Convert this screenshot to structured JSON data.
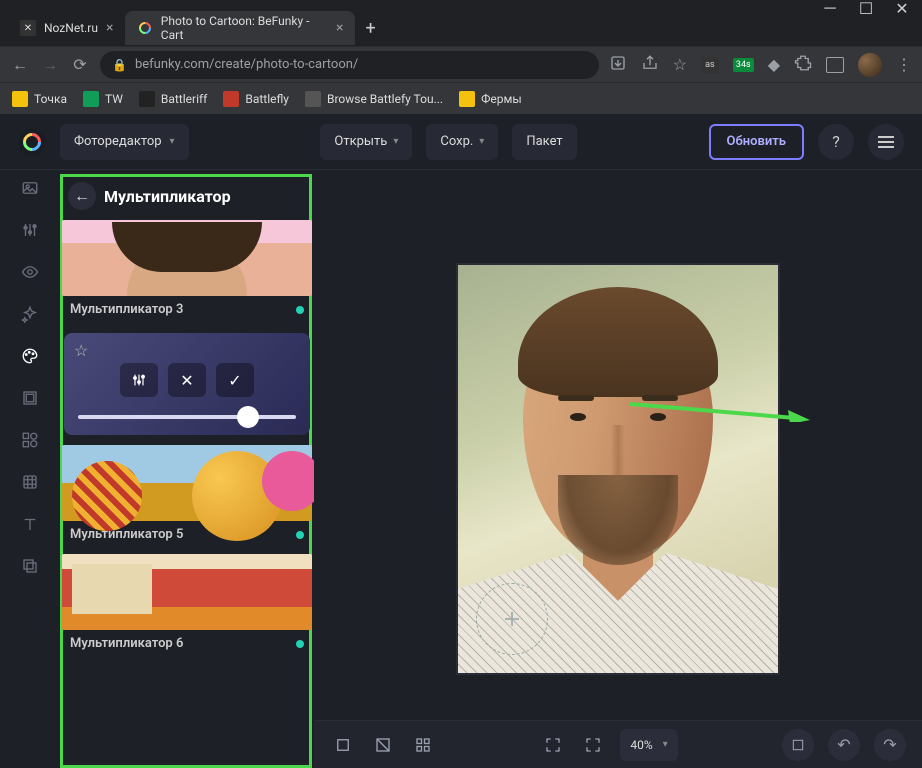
{
  "browser": {
    "tabs": [
      {
        "title": "NozNet.ru",
        "active": false
      },
      {
        "title": "Photo to Cartoon: BeFunky - Cart",
        "active": true
      }
    ],
    "url": "befunky.com/create/photo-to-cartoon/",
    "bookmarks": [
      {
        "label": "Точка",
        "color": "#f4c20d"
      },
      {
        "label": "TW",
        "color": "#0f9d58"
      },
      {
        "label": "Battleriff",
        "color": "#333"
      },
      {
        "label": "Battlefly",
        "color": "#c0392b"
      },
      {
        "label": "Browse Battlefy Tou...",
        "color": "#555"
      },
      {
        "label": "Фермы",
        "color": "#f4c20d"
      }
    ],
    "ext_badge": "34s"
  },
  "appbar": {
    "mode": "Фоторедактор",
    "open": "Открыть",
    "save": "Сохр.",
    "batch": "Пакет",
    "upgrade": "Обновить"
  },
  "panel": {
    "title": "Мультипликатор",
    "effects": [
      {
        "label": "Мультипликатор 3"
      },
      {
        "label": "Мультипликатор 5"
      },
      {
        "label": "Мультипликатор 6"
      }
    ],
    "slider_value": 82
  },
  "zoom": "40%"
}
